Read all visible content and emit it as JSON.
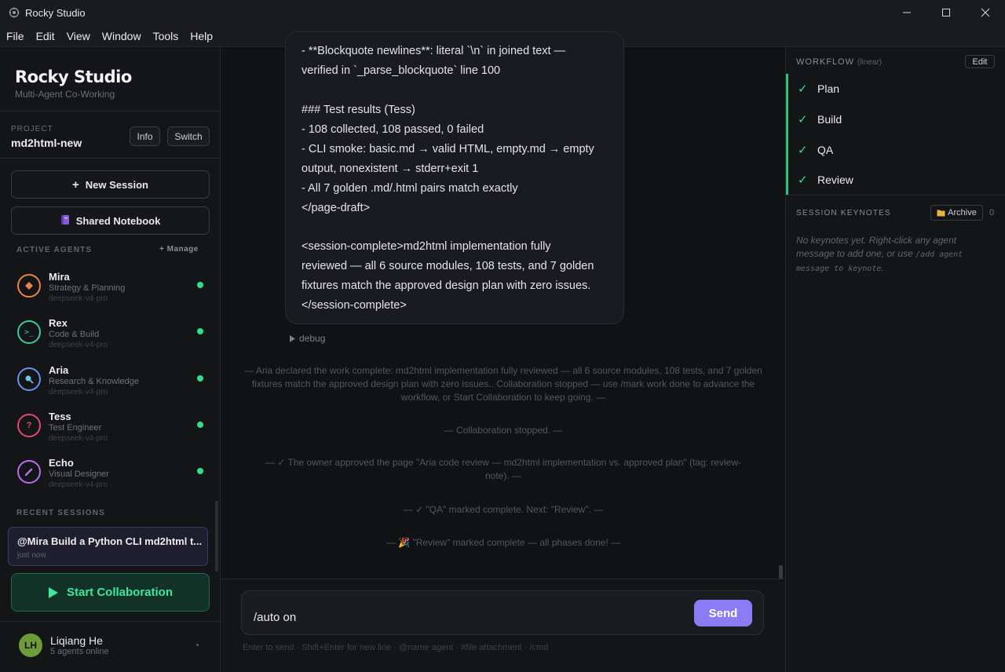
{
  "window": {
    "title": "Rocky Studio"
  },
  "menu": [
    "File",
    "Edit",
    "View",
    "Window",
    "Tools",
    "Help"
  ],
  "sidebar": {
    "brand": "Rocky Studio",
    "tagline": "Multi-Agent Co-Working",
    "project_label": "PROJECT",
    "project_name": "md2html-new",
    "info_label": "Info",
    "switch_label": "Switch",
    "new_session_label": "New Session",
    "notebook_label": "Shared Notebook",
    "active_agents_label": "ACTIVE AGENTS",
    "manage_label": "+ Manage",
    "agents": [
      {
        "name": "Mira",
        "role": "Strategy & Planning",
        "model": "deepseek-v4-pro",
        "color": "#e8854a"
      },
      {
        "name": "Rex",
        "role": "Code & Build",
        "model": "deepseek-v4-pro",
        "color": "#3ec99a"
      },
      {
        "name": "Aria",
        "role": "Research & Knowledge",
        "model": "deepseek-v4-pro",
        "color": "#6b8ef0"
      },
      {
        "name": "Tess",
        "role": "Test Engineer",
        "model": "deepseek-v4-pro",
        "color": "#e0487a"
      },
      {
        "name": "Echo",
        "role": "Visual Designer",
        "model": "deepseek-v4-pro",
        "color": "#b86cf0"
      }
    ],
    "recent_sessions_label": "RECENT SESSIONS",
    "recent_session": {
      "title": "@Mira Build a Python CLI md2html t...",
      "time": "just now"
    },
    "start_label": "Start Collaboration",
    "user": {
      "initials": "LH",
      "name": "Liqiang He",
      "status": "5 agents online"
    }
  },
  "chat": {
    "bubble_lines": [
      "- **Blockquote newlines**: literal `\\n` in joined text —",
      "verified in `_parse_blockquote` line 100",
      "",
      "### Test results (Tess)",
      "- 108 collected, 108 passed, 0 failed",
      "- CLI smoke: basic.md → valid HTML, empty.md → empty",
      "output, nonexistent → stderr+exit 1",
      "- All 7 golden .md/.html pairs match exactly",
      "</page-draft>",
      "",
      "<session-complete>md2html implementation fully",
      "reviewed — all 6 source modules, 108 tests, and 7 golden",
      "fixtures match the approved design plan with zero issues.",
      "</session-complete>"
    ],
    "debug_label": "debug",
    "system_messages": [
      "— Aria declared the work complete: md2html implementation fully reviewed — all 6 source modules, 108 tests, and 7 golden fixtures match the approved design plan with zero issues.. Collaboration stopped — use /mark work done to advance the workflow, or Start Collaboration to keep going. —",
      "— Collaboration stopped. —",
      "— ✓ The owner approved the page \"Aria code review — md2html implementation vs. approved plan\" (tag: review-note). —",
      "— ✓ \"QA\" marked complete. Next: \"Review\". —",
      "— 🎉 \"Review\" marked complete — all phases done! —"
    ],
    "composer_value": "/auto on",
    "send_label": "Send",
    "hint": "Enter to send · Shift+Enter for new line · @name agent · #file attachment · /cmd"
  },
  "workflow": {
    "label": "WORKFLOW",
    "mode": "(linear)",
    "edit_label": "Edit",
    "phases": [
      "Plan",
      "Build",
      "QA",
      "Review"
    ],
    "accent": "#2ec27e"
  },
  "keynotes": {
    "label": "SESSION KEYNOTES",
    "archive_label": "Archive",
    "count": "0",
    "empty_before": "No keynotes yet. Right-click any agent message to add one, or use ",
    "empty_code": "/add agent message to keynote",
    "empty_after": "."
  }
}
